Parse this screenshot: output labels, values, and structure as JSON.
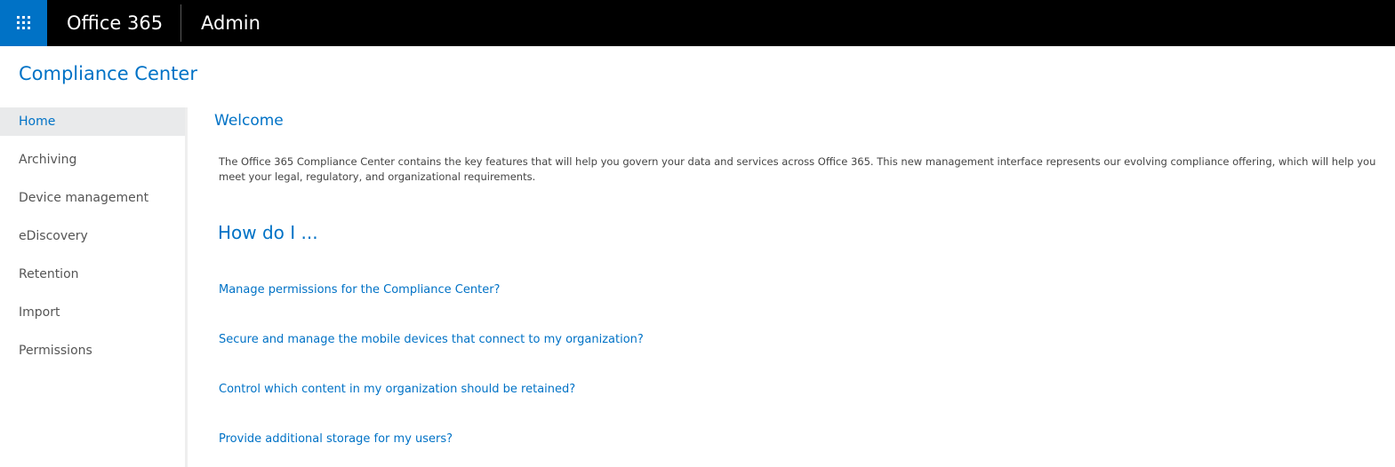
{
  "header": {
    "suite_title": "Office 365",
    "app_title": "Admin",
    "launcher_icon": "app-launcher-waffle-icon",
    "background_color": "#000000",
    "launcher_color": "#0072c6"
  },
  "page": {
    "title": "Compliance Center",
    "accent_color": "#0072c6"
  },
  "sidebar": {
    "items": [
      {
        "label": "Home",
        "selected": true
      },
      {
        "label": "Archiving",
        "selected": false
      },
      {
        "label": "Device management",
        "selected": false
      },
      {
        "label": "eDiscovery",
        "selected": false
      },
      {
        "label": "Retention",
        "selected": false
      },
      {
        "label": "Import",
        "selected": false
      },
      {
        "label": "Permissions",
        "selected": false
      }
    ]
  },
  "main": {
    "welcome_heading": "Welcome",
    "intro_text": "The Office 365 Compliance Center contains the key features that will help you govern your data and services across Office 365. This new management interface represents our evolving compliance offering, which will help you meet your legal, regulatory, and organizational requirements.",
    "how_heading": "How do I ...",
    "links": [
      "Manage permissions for the Compliance Center?",
      "Secure and manage the mobile devices that connect to my organization?",
      "Control which content in my organization should be retained?",
      "Provide additional storage for my users?"
    ]
  }
}
